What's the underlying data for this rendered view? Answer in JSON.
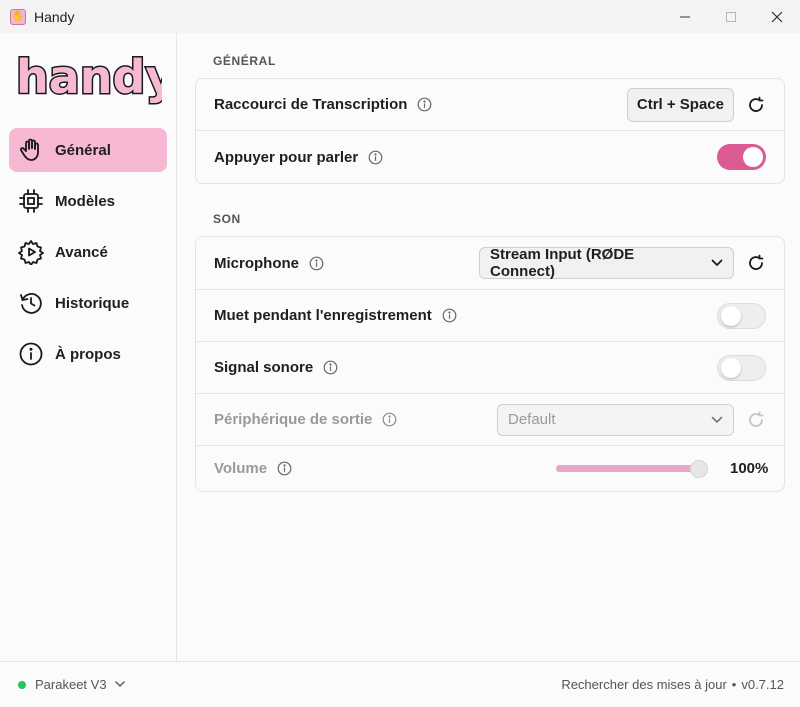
{
  "window": {
    "title": "Handy",
    "app_icon": "handy-app-icon",
    "controls": {
      "minimize": "minimize-icon",
      "maximize": "maximize-icon",
      "close": "close-icon"
    }
  },
  "sidebar": {
    "logo_text": "handy",
    "items": [
      {
        "label": "Général",
        "icon": "hand-icon",
        "active": true
      },
      {
        "label": "Modèles",
        "icon": "chip-icon",
        "active": false
      },
      {
        "label": "Avancé",
        "icon": "gear-play-icon",
        "active": false
      },
      {
        "label": "Historique",
        "icon": "history-icon",
        "active": false
      },
      {
        "label": "À propos",
        "icon": "info-circle-icon",
        "active": false
      }
    ]
  },
  "sections": {
    "general": {
      "title": "GÉNÉRAL",
      "rows": {
        "shortcut": {
          "label": "Raccourci de Transcription",
          "value": "Ctrl + Space"
        },
        "push_to_talk": {
          "label": "Appuyer pour parler",
          "toggle": true
        }
      }
    },
    "sound": {
      "title": "SON",
      "rows": {
        "microphone": {
          "label": "Microphone",
          "value": "Stream Input (RØDE Connect)"
        },
        "mute": {
          "label": "Muet pendant l'enregistrement",
          "toggle": false
        },
        "beep": {
          "label": "Signal sonore",
          "toggle": false
        },
        "output": {
          "label": "Périphérique de sortie",
          "value": "Default",
          "disabled": true
        },
        "volume": {
          "label": "Volume",
          "value_text": "100%",
          "level": 1.0,
          "disabled": true
        }
      }
    }
  },
  "footer": {
    "model": "Parakeet V3",
    "status_color": "#22c55e",
    "updates": "Rechercher des mises à jour",
    "separator": "•",
    "version": "v0.7.12"
  },
  "colors": {
    "accent": "#dc5b92",
    "active_nav": "#f7b8d3",
    "slider": "#eaa7c5"
  }
}
